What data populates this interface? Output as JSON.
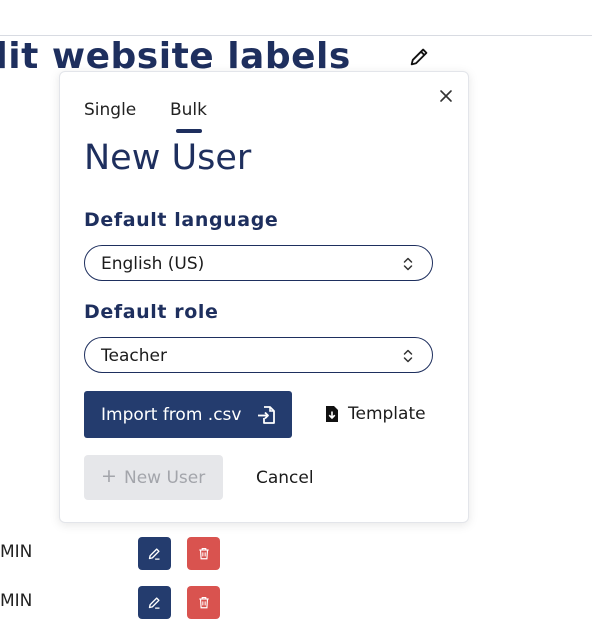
{
  "page": {
    "title": "dit website labels"
  },
  "rows": [
    {
      "label": "MIN"
    },
    {
      "label": "MIN"
    }
  ],
  "modal": {
    "tabs": [
      {
        "label": "Single"
      },
      {
        "label": "Bulk",
        "active": true
      }
    ],
    "heading": "New User",
    "language_label": "Default language",
    "language_value": "English (US)",
    "role_label": "Default role",
    "role_value": "Teacher",
    "import_label": "Import from .csv",
    "template_label": "Template",
    "new_user_label": "New User",
    "new_user_plus": "+",
    "cancel_label": "Cancel"
  },
  "colors": {
    "primary": "#243c6e",
    "heading": "#1e2f5e",
    "danger": "#d9534f",
    "disabled_bg": "#e6e7ea"
  },
  "icons": {
    "title_edit": "pencil-icon",
    "close": "close-icon",
    "select_chevron": "chevron-updown-icon",
    "import": "file-import-icon",
    "template": "file-download-icon",
    "row_edit": "edit-icon",
    "row_delete": "trash-icon"
  }
}
